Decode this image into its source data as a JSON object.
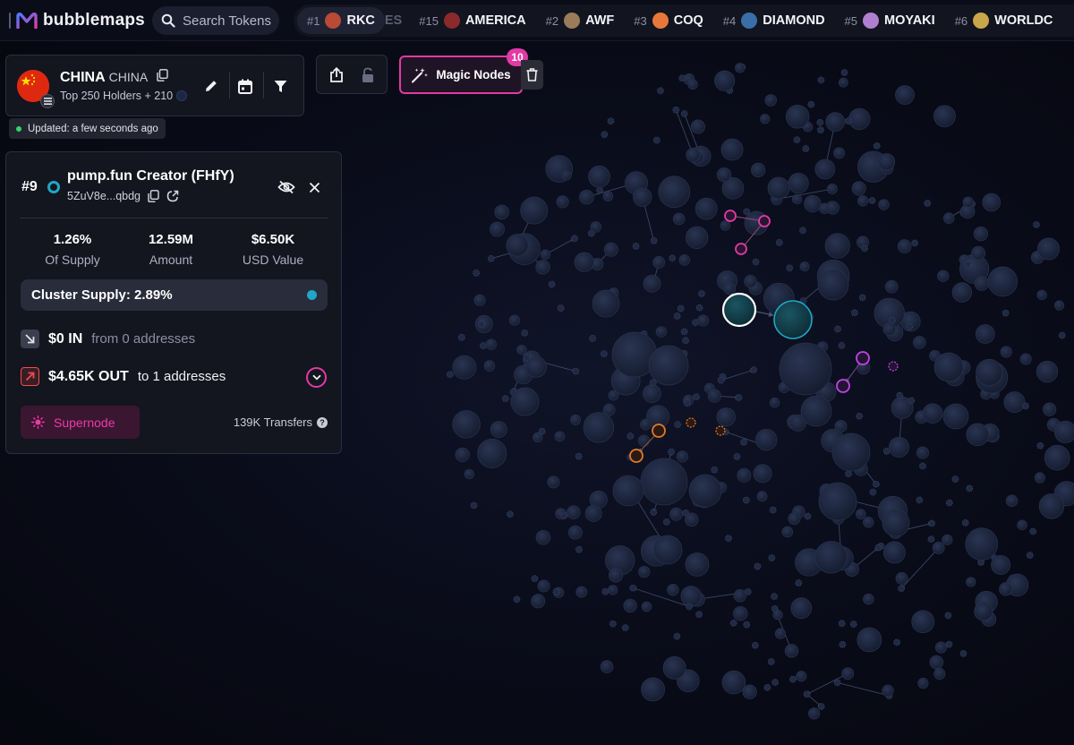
{
  "app": {
    "name": "bubblemaps"
  },
  "search": {
    "placeholder": "Search Tokens"
  },
  "ticker": {
    "items": [
      {
        "rank": "#1",
        "name": "RKC",
        "avatar_color": "#b84a36"
      },
      {
        "rank": "#15",
        "name": "AMERICA",
        "avatar_color": "#8a2a2a"
      },
      {
        "rank": "#2",
        "name": "AWF",
        "avatar_color": "#9a7b5a"
      },
      {
        "rank": "#3",
        "name": "COQ",
        "avatar_color": "#e8783a"
      },
      {
        "rank": "#4",
        "name": "DIAMOND",
        "avatar_color": "#3a6ea8"
      },
      {
        "rank": "#5",
        "name": "MOYAKI",
        "avatar_color": "#b17fd0"
      },
      {
        "rank": "#6",
        "name": "WORLDC",
        "avatar_color": "#c9a64a"
      }
    ],
    "faded_text": "ES"
  },
  "token": {
    "name": "CHINA",
    "symbol": "CHINA",
    "subtitle": "Top 250 Holders + 210",
    "updated": "Updated: a few seconds ago"
  },
  "toolbar": {
    "magic_nodes_label": "Magic Nodes",
    "magic_nodes_count": "10"
  },
  "details": {
    "rank": "#9",
    "name": "pump.fun Creator (FHfY)",
    "address": "5ZuV8e...qbdg",
    "stats": [
      {
        "value": "1.26%",
        "label": "Of Supply"
      },
      {
        "value": "12.59M",
        "label": "Amount"
      },
      {
        "value": "$6.50K",
        "label": "USD Value"
      }
    ],
    "cluster_supply": "Cluster Supply: 2.89%",
    "in_amount": "$0 IN",
    "in_desc": "from 0 addresses",
    "out_amount": "$4.65K OUT",
    "out_desc": "to 1 addresses",
    "supernode_label": "Supernode",
    "transfers": "139K Transfers"
  },
  "colors": {
    "accent_pink": "#e13aa5",
    "teal": "#1ea7c6",
    "bubble": "#1b2640",
    "orange": "#e2782a",
    "purple": "#c144e6"
  }
}
